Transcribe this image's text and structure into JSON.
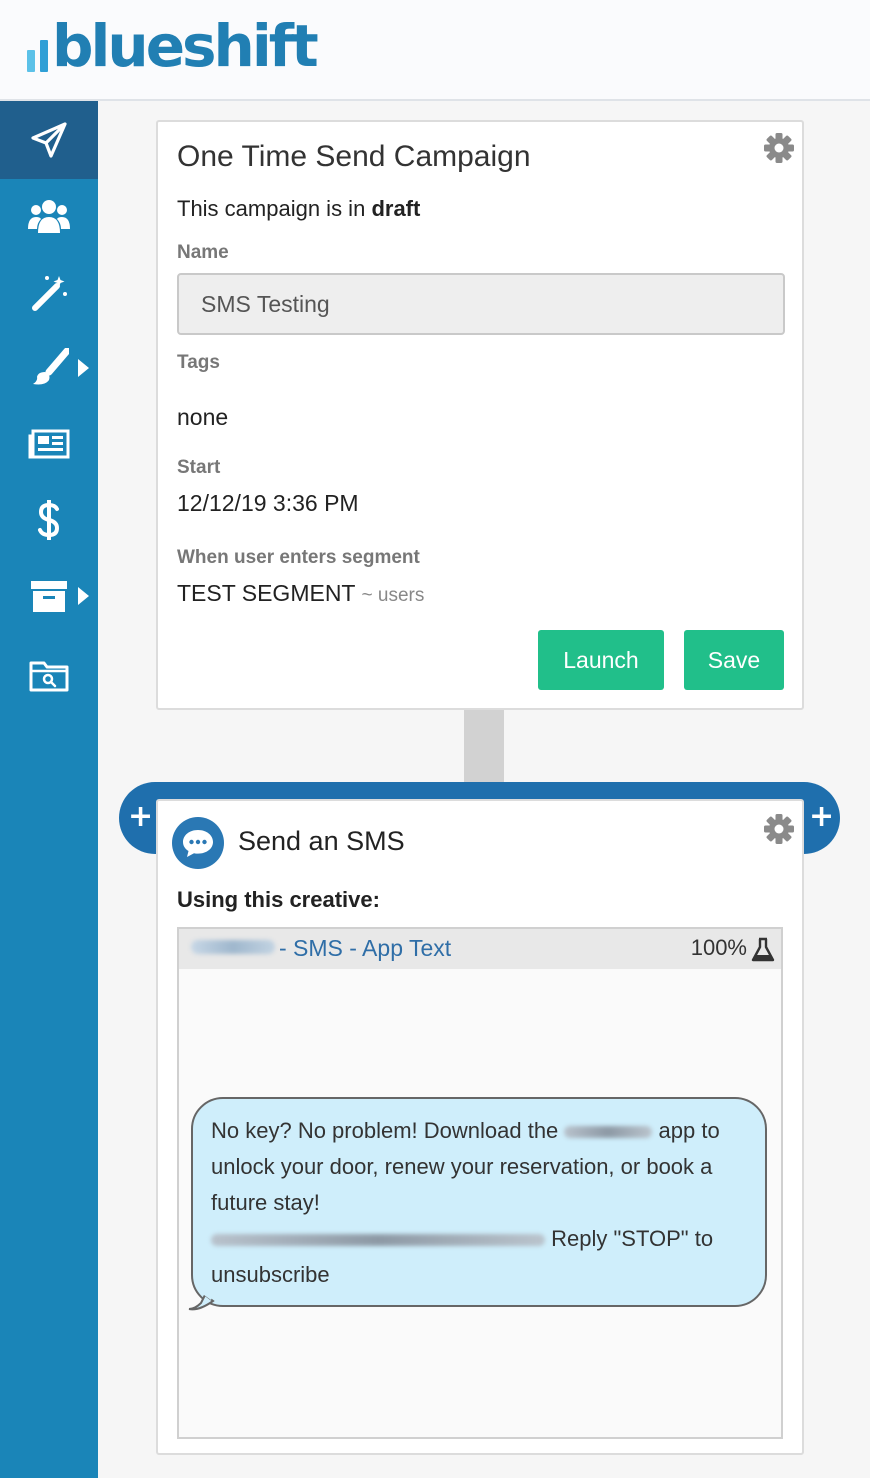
{
  "brand": {
    "name": "blueshift",
    "bar_colors": [
      "#5bc1e8",
      "#2f9fd6",
      "#1f6fad"
    ],
    "text_color": "#217fb3"
  },
  "sidebar": {
    "items": [
      {
        "icon": "paper-plane-icon",
        "active": true
      },
      {
        "icon": "users-icon"
      },
      {
        "icon": "magic-wand-icon"
      },
      {
        "icon": "paint-brush-icon",
        "has_submenu": true
      },
      {
        "icon": "newspaper-icon"
      },
      {
        "icon": "dollar-icon"
      },
      {
        "icon": "archive-icon",
        "has_submenu": true
      },
      {
        "icon": "folder-search-icon"
      }
    ]
  },
  "campaign": {
    "title": "One Time Send Campaign",
    "status_prefix": "This campaign is in",
    "status_value": "draft",
    "name_label": "Name",
    "name_value": "SMS Testing",
    "tags_label": "Tags",
    "tags_value": "none",
    "start_label": "Start",
    "start_value": "12/12/19 3:36 PM",
    "trigger_label": "When user enters segment",
    "segment_name": "TEST SEGMENT",
    "segment_users": "~ users",
    "launch_label": "Launch",
    "save_label": "Save"
  },
  "sms_step": {
    "title": "Send an SMS",
    "using_label": "Using this creative:",
    "creative_name": "- SMS - App Text",
    "percentage": "100%",
    "message_part1": "No key? No problem! Download the",
    "message_part2": "app to unlock your door, renew your reservation, or book a future stay!",
    "message_part3": "Reply \"STOP\" to unsubscribe",
    "add_icon": "plus-icon"
  },
  "colors": {
    "sidebar": "#1a85b8",
    "sidebar_active": "#205f8d",
    "button": "#21bf8a",
    "band": "#1f6fad",
    "bubble": "#cfeefb"
  }
}
